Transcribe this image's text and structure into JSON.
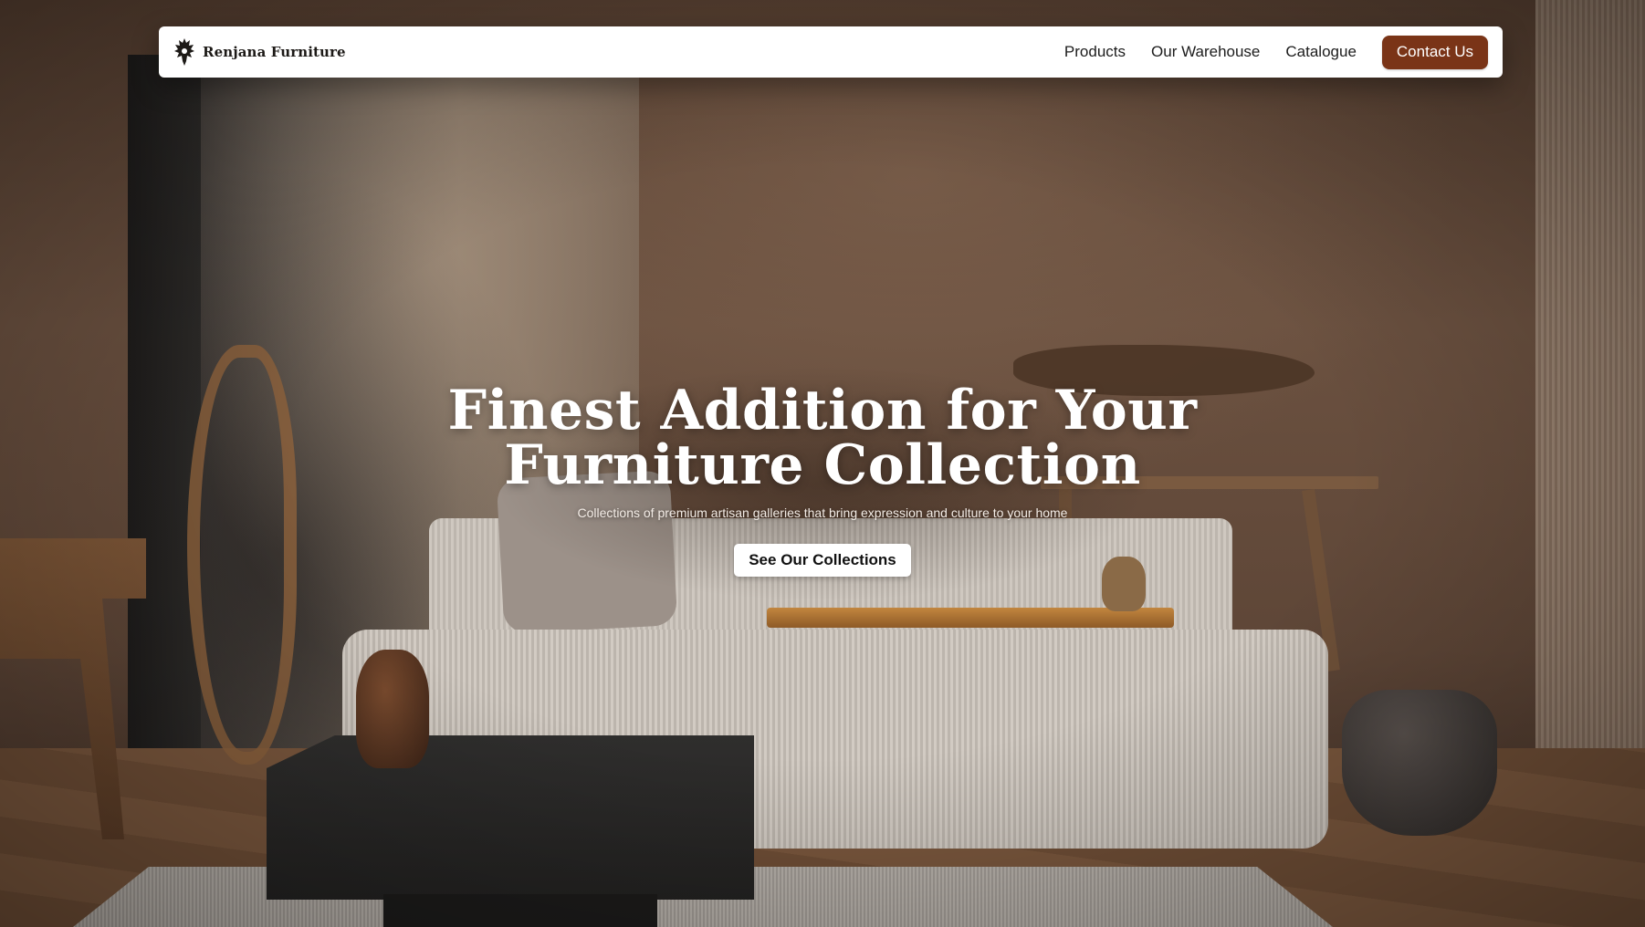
{
  "navbar": {
    "brand_name": "Renjana Furniture",
    "brand_icon": "ornamental-crest-icon",
    "links": [
      {
        "label": "Products"
      },
      {
        "label": "Our Warehouse"
      },
      {
        "label": "Catalogue"
      }
    ],
    "contact_label": "Contact Us"
  },
  "hero": {
    "title_line_1": "Finest Addition for Your",
    "title_line_2": "Furniture Collection",
    "subtitle": "Collections of premium artisan galleries that bring expression and culture to your home",
    "cta_label": "See Our Collections",
    "background": "living room interior with corduroy sofa, black coffee table, driftwood decor and potted branches"
  },
  "colors": {
    "accent": "#7a3417",
    "navbar_bg": "#ffffff",
    "text_dark": "#1c1c1c",
    "hero_text": "#ffffff"
  }
}
